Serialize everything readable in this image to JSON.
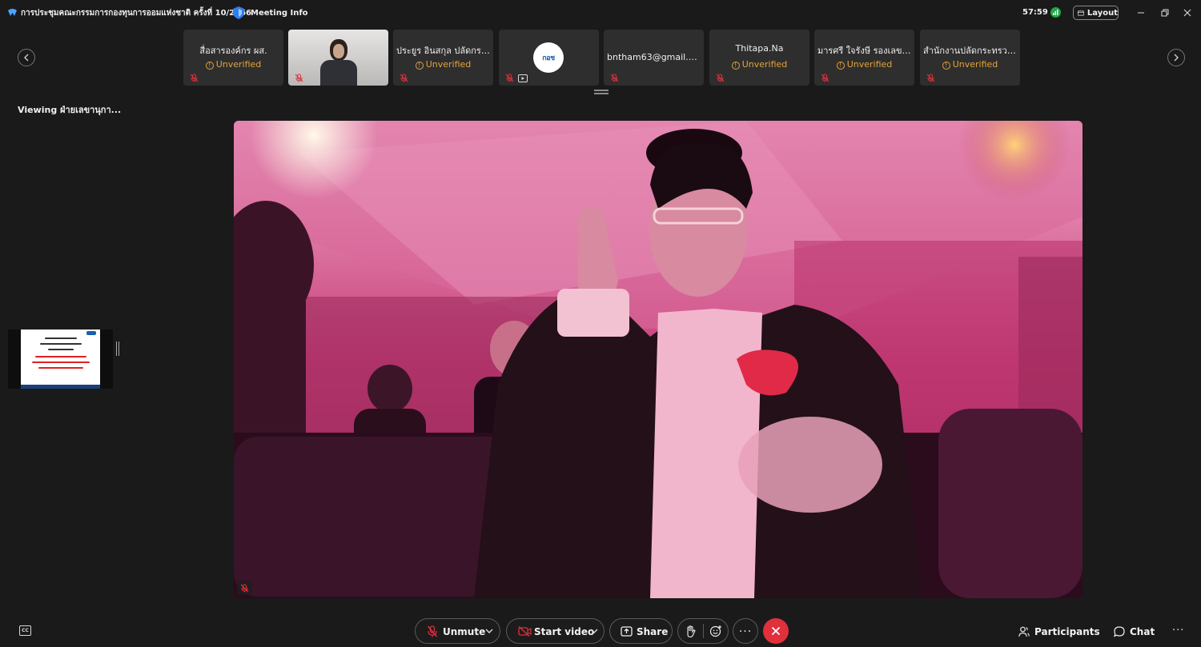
{
  "window": {
    "title": "การประชุมคณะกรรมการกองทุนการออมแห่งชาติ ครั้งที่ 10/2566",
    "meeting_info_label": "Meeting Info",
    "timer": "57:59",
    "layout_label": "Layout"
  },
  "participants": [
    {
      "name": "สื่อสารองค์กร ผส.",
      "status": "Unverified",
      "kind": "text"
    },
    {
      "name": "",
      "status": "",
      "kind": "video"
    },
    {
      "name": "ประยูร อินสกุล ปลัดกระ...",
      "status": "Unverified",
      "kind": "text"
    },
    {
      "name": "",
      "status": "",
      "kind": "logo",
      "logo_text": "กอช"
    },
    {
      "name": "bntham63@gmail.com",
      "status": "",
      "kind": "text"
    },
    {
      "name": "Thitapa.Na",
      "status": "Unverified",
      "kind": "text"
    },
    {
      "name": "มารศรี ใจรังษี รองเลขา...",
      "status": "Unverified",
      "kind": "text"
    },
    {
      "name": "สำนักงานปลัดกระทรวง...",
      "status": "Unverified",
      "kind": "text"
    }
  ],
  "viewing": {
    "label": "Viewing ฝ่ายเลขานุกา..."
  },
  "toolbar": {
    "unmute_label": "Unmute",
    "start_video_label": "Start video",
    "share_label": "Share",
    "more_label": "...",
    "participants_label": "Participants",
    "chat_label": "Chat",
    "overflow_label": "...",
    "cc_label": "CC"
  },
  "colors": {
    "background": "#1a1a1a",
    "tile": "#2e2e2e",
    "unverified": "#e5a437",
    "muted_red": "#e0303c",
    "signal_green": "#1fa74a"
  },
  "icons": [
    "app-logo-icon",
    "shield-icon",
    "signal-icon",
    "layout-icon",
    "minimize-icon",
    "restore-icon",
    "close-icon",
    "chevron-left-icon",
    "chevron-right-icon",
    "mic-off-icon",
    "camera-icon",
    "video-off-icon",
    "share-icon",
    "raise-hand-icon",
    "emoji-icon",
    "end-call-icon",
    "participants-icon",
    "chat-icon",
    "closed-caption-icon"
  ]
}
